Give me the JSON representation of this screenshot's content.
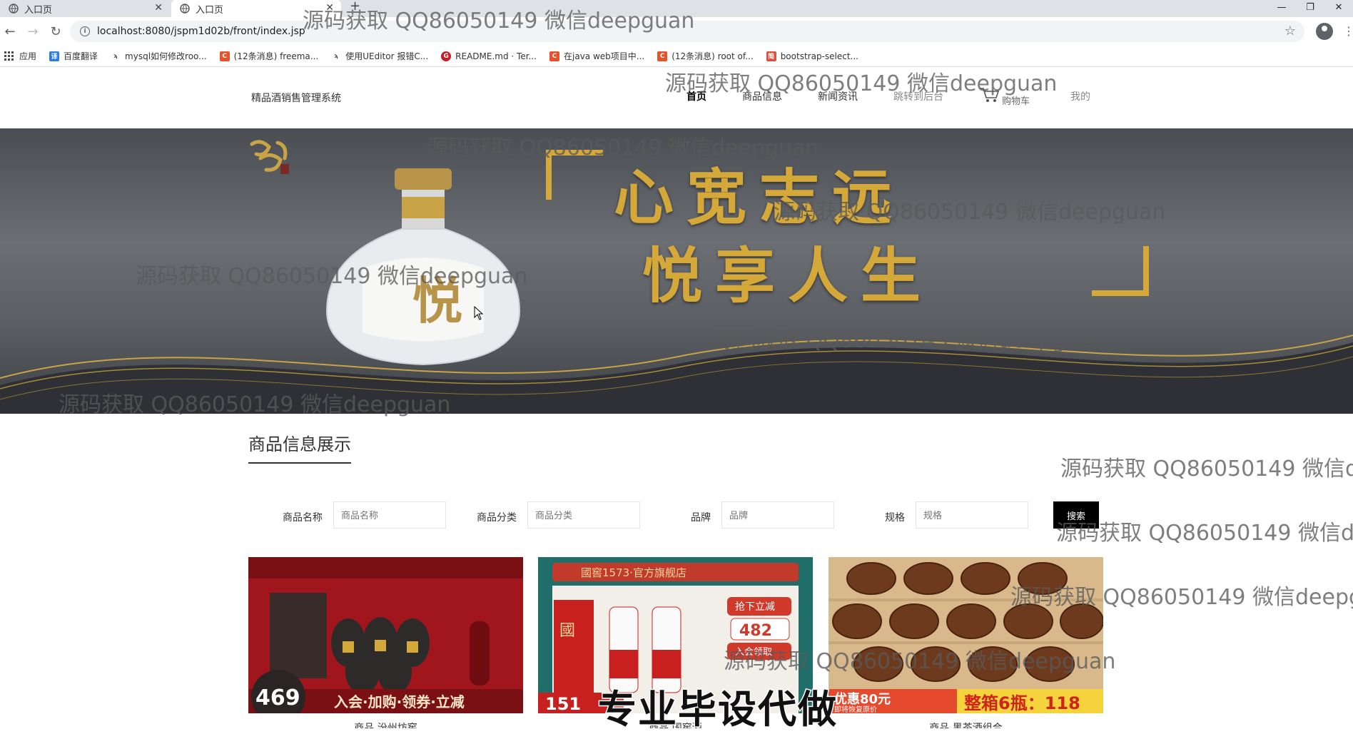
{
  "browser": {
    "tabs": [
      {
        "title": "入口页"
      },
      {
        "title": "入口页"
      }
    ],
    "url": "localhost:8080/jspm1d02b/front/index.jsp",
    "bookmarks": [
      {
        "label": "应用"
      },
      {
        "label": "百度翻译"
      },
      {
        "label": "mysql如何修改roo..."
      },
      {
        "label": "(12条消息) freema..."
      },
      {
        "label": "使用UEditor 报错C..."
      },
      {
        "label": "README.md · Ter..."
      },
      {
        "label": "在java web项目中..."
      },
      {
        "label": "(12条消息) root of..."
      },
      {
        "label": "bootstrap-select..."
      }
    ]
  },
  "site": {
    "brand": "精品酒销售管理系统",
    "nav": [
      {
        "label": "首页"
      },
      {
        "label": "商品信息"
      },
      {
        "label": "新闻资讯"
      },
      {
        "label": "跳转到后台"
      },
      {
        "label": "购物车"
      },
      {
        "label": "我的"
      }
    ],
    "banner": {
      "slogan_line1": "心宽志远",
      "slogan_line2": "悦享人生"
    },
    "section_title": "商品信息展示",
    "search": {
      "fields": [
        {
          "label": "商品名称",
          "placeholder": "商品名称"
        },
        {
          "label": "商品分类",
          "placeholder": "商品分类"
        },
        {
          "label": "品牌",
          "placeholder": "品牌"
        },
        {
          "label": "规格",
          "placeholder": "规格"
        }
      ],
      "button": "搜索"
    },
    "products": [
      {
        "caption": "商品 汾州坊窖",
        "price_tag": "469",
        "promo": "入会·加购·领券·立减"
      },
      {
        "caption": "商品 国窖酒",
        "store": "國窖1573·官方旗舰店",
        "price_tag": "482",
        "badge_top": "抢下立减",
        "badge_bottom": "入会领取",
        "bottom_price": "151"
      },
      {
        "caption": "商品 黑茶酒组合",
        "promo_left": "优惠80元",
        "promo_sub": "即将恢复原价",
        "promo_right": "整箱6瓶：118"
      }
    ]
  },
  "watermark": "源码获取 QQ86050149 微信deepguan",
  "stamp": "专业毕设代做"
}
